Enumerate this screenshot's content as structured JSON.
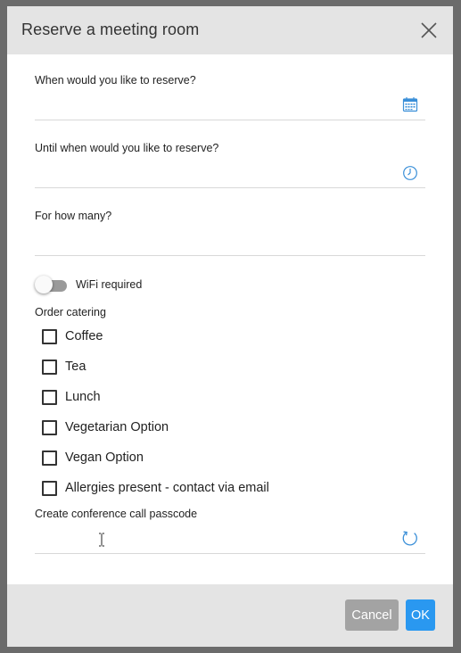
{
  "dialog": {
    "title": "Reserve a meeting room"
  },
  "form": {
    "start": {
      "label": "When would you like to reserve?",
      "value": "",
      "icon": "calendar-icon"
    },
    "end": {
      "label": "Until when would you like to reserve?",
      "value": "",
      "icon": "clock-icon"
    },
    "count": {
      "label": "For how many?",
      "value": ""
    },
    "wifi": {
      "label": "WiFi required",
      "checked": false
    },
    "catering": {
      "label": "Order catering",
      "options": [
        {
          "label": "Coffee",
          "checked": false
        },
        {
          "label": "Tea",
          "checked": false
        },
        {
          "label": "Lunch",
          "checked": false
        },
        {
          "label": "Vegetarian Option",
          "checked": false
        },
        {
          "label": "Vegan Option",
          "checked": false
        },
        {
          "label": "Allergies present - contact via email",
          "checked": false
        }
      ]
    },
    "passcode": {
      "label": "Create conference call passcode",
      "value": "",
      "icon": "refresh-icon"
    }
  },
  "footer": {
    "cancel_label": "Cancel",
    "ok_label": "OK"
  },
  "colors": {
    "accent": "#2a98f0",
    "header_bg": "#e4e4e4",
    "cancel_bg": "#a3a3a3",
    "overlay": "#6b6b6b"
  }
}
